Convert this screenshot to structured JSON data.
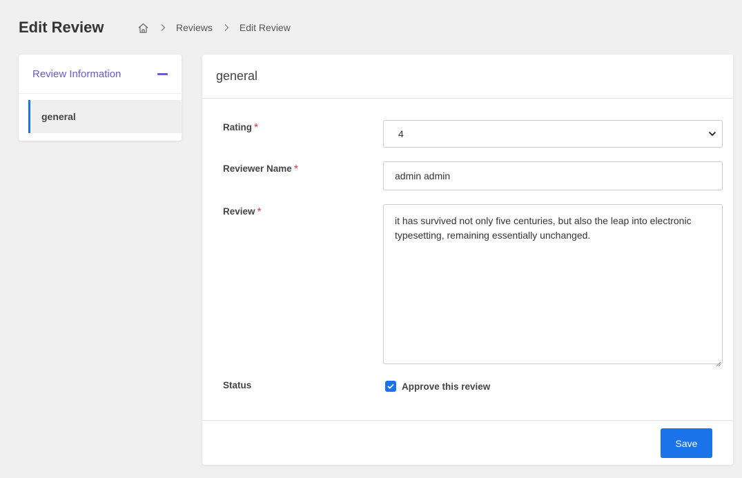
{
  "page": {
    "title": "Edit Review"
  },
  "breadcrumb": {
    "home_icon": "home-icon",
    "items": [
      "Reviews",
      "Edit Review"
    ]
  },
  "sidebar": {
    "section_title": "Review Information",
    "collapse_icon": "minus-icon",
    "items": [
      {
        "label": "general",
        "active": true
      }
    ]
  },
  "form": {
    "section_title": "general",
    "rating": {
      "label": "Rating",
      "required_mark": "*",
      "value": "4"
    },
    "reviewer_name": {
      "label": "Reviewer Name",
      "required_mark": "*",
      "value": "admin admin"
    },
    "review": {
      "label": "Review",
      "required_mark": "*",
      "value": "it has survived not only five centuries, but also the leap into electronic typesetting, remaining essentially unchanged."
    },
    "status": {
      "label": "Status",
      "checkbox_label": "Approve this review",
      "checked": true
    },
    "save_label": "Save"
  },
  "colors": {
    "accent": "#1a73e8",
    "sidebar_title": "#6a5acd",
    "required": "#e53935",
    "background": "#f0f0f0"
  }
}
